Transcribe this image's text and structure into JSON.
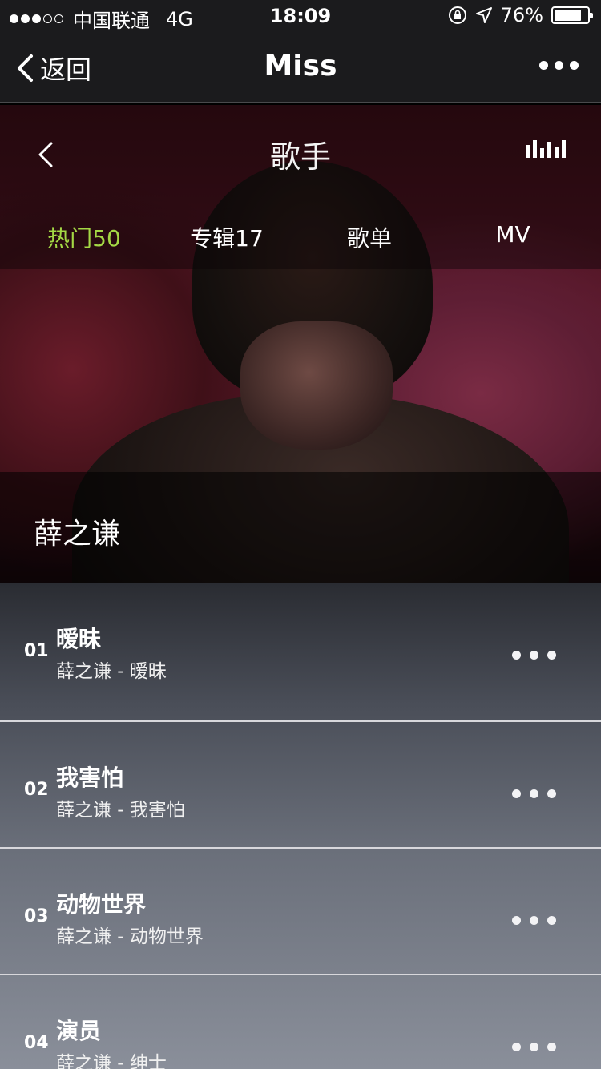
{
  "status": {
    "carrier": "中国联通",
    "network": "4G",
    "time": "18:09",
    "battery": "76%",
    "battery_level": 0.76
  },
  "nav": {
    "back_label": "返回",
    "title": "Miss"
  },
  "hero": {
    "title": "歌手",
    "tabs": [
      "热门50",
      "专辑17",
      "歌单",
      "MV"
    ],
    "artist": "薛之谦"
  },
  "songs": [
    {
      "num": "01",
      "title": "暧昧",
      "subtitle": "薛之谦 - 暧昧"
    },
    {
      "num": "02",
      "title": "我害怕",
      "subtitle": "薛之谦 - 我害怕"
    },
    {
      "num": "03",
      "title": "动物世界",
      "subtitle": "薛之谦 - 动物世界"
    },
    {
      "num": "04",
      "title": "演员",
      "subtitle": "薛之谦 - 绅士"
    }
  ],
  "colors": {
    "active_tab": "#a4d845",
    "nav_bg": "#1b1b1d"
  }
}
